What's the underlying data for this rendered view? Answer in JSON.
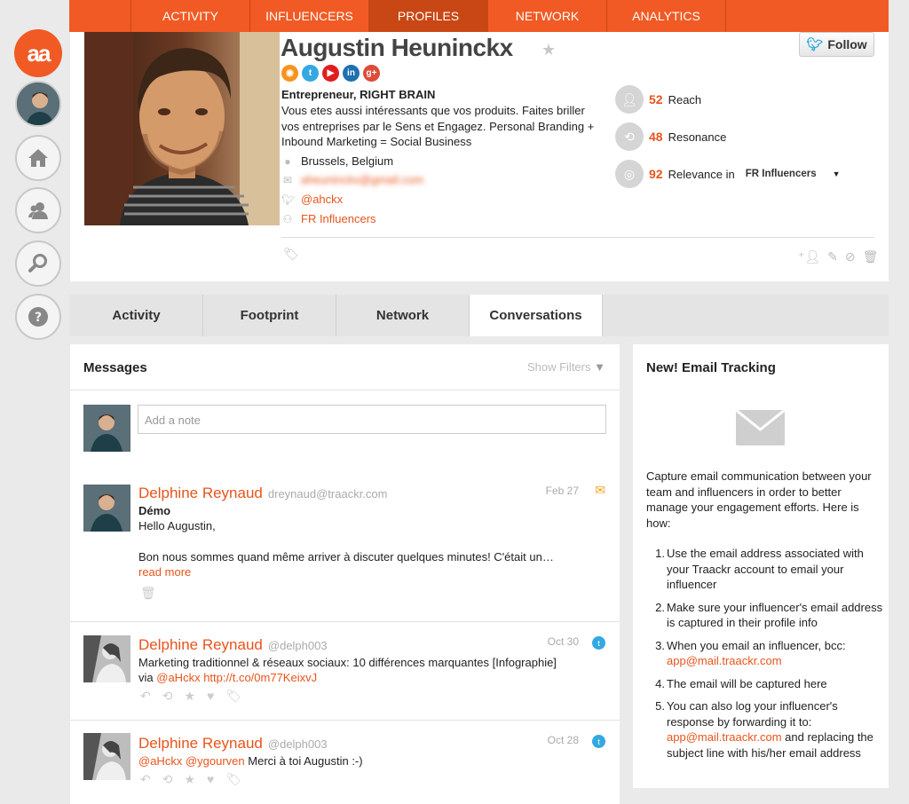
{
  "nav": {
    "items": [
      "ACTIVITY",
      "INFLUENCERS",
      "PROFILES",
      "NETWORK",
      "ANALYTICS"
    ],
    "active": "PROFILES"
  },
  "sidebar": {
    "logo": "aa",
    "icons": [
      "home-icon",
      "user-icon",
      "search-icon",
      "help-icon"
    ]
  },
  "profile": {
    "name": "Augustin Heuninckx",
    "follow_label": "Follow",
    "socials": [
      "rss",
      "twitter",
      "youtube",
      "linkedin",
      "google-plus"
    ],
    "role": "Entrepreneur, RIGHT BRAIN",
    "bio": "Vous etes aussi intéressants que vos produits. Faites briller vos entreprises par le Sens et Engagez. Personal Branding + Inbound Marketing = Social Business",
    "location": "Brussels, Belgium",
    "email": "aheuninckx@gmail.com",
    "twitter": "@ahckx",
    "list": "FR Influencers"
  },
  "stats": {
    "reach_value": "52",
    "reach_label": "Reach",
    "resonance_value": "48",
    "resonance_label": "Resonance",
    "relevance_value": "92",
    "relevance_label": "Relevance in",
    "relevance_list": "FR Influencers"
  },
  "tabs": [
    "Activity",
    "Footprint",
    "Network",
    "Conversations"
  ],
  "active_tab": "Conversations",
  "messages": {
    "title": "Messages",
    "show_filters": "Show Filters",
    "note_placeholder": "Add a note",
    "items": [
      {
        "author": "Delphine Reynaud",
        "handle": "dreynaud@traackr.com",
        "date": "Feb 27",
        "subject": "Démo",
        "line1": "Hello Augustin,",
        "line2": "Bon nous sommes quand même arriver à discuter quelques minutes! C'était un…",
        "read_more": "read more"
      },
      {
        "author": "Delphine Reynaud",
        "handle": "@delph003",
        "date": "Oct 30",
        "text": "Marketing traditionnel & réseaux sociaux: 10 différences marquantes [Infographie]",
        "via": "via",
        "mention": "@aHckx",
        "link": "http://t.co/0m77KeixvJ"
      },
      {
        "author": "Delphine Reynaud",
        "handle": "@delph003",
        "date": "Oct 28",
        "mention1": "@aHckx",
        "mention2": "@ygourven",
        "text": "Merci à toi Augustin :-)"
      }
    ]
  },
  "email_tracking": {
    "title": "New! Email Tracking",
    "description": "Capture email communication between your team and influencers in order to better manage your engagement efforts. Here is how:",
    "steps": [
      "Use the email address associated with your Traackr account to email your influencer",
      "Make sure your influencer's email address is captured in their profile info",
      "When you email an influencer, bcc:",
      "The email will be captured here",
      "You can also log your influencer's response by forwarding it to:"
    ],
    "bcc_address": "app@mail.traackr.com",
    "forward_address": "app@mail.traackr.com",
    "forward_suffix": "and replacing the subject line with his/her email address"
  }
}
